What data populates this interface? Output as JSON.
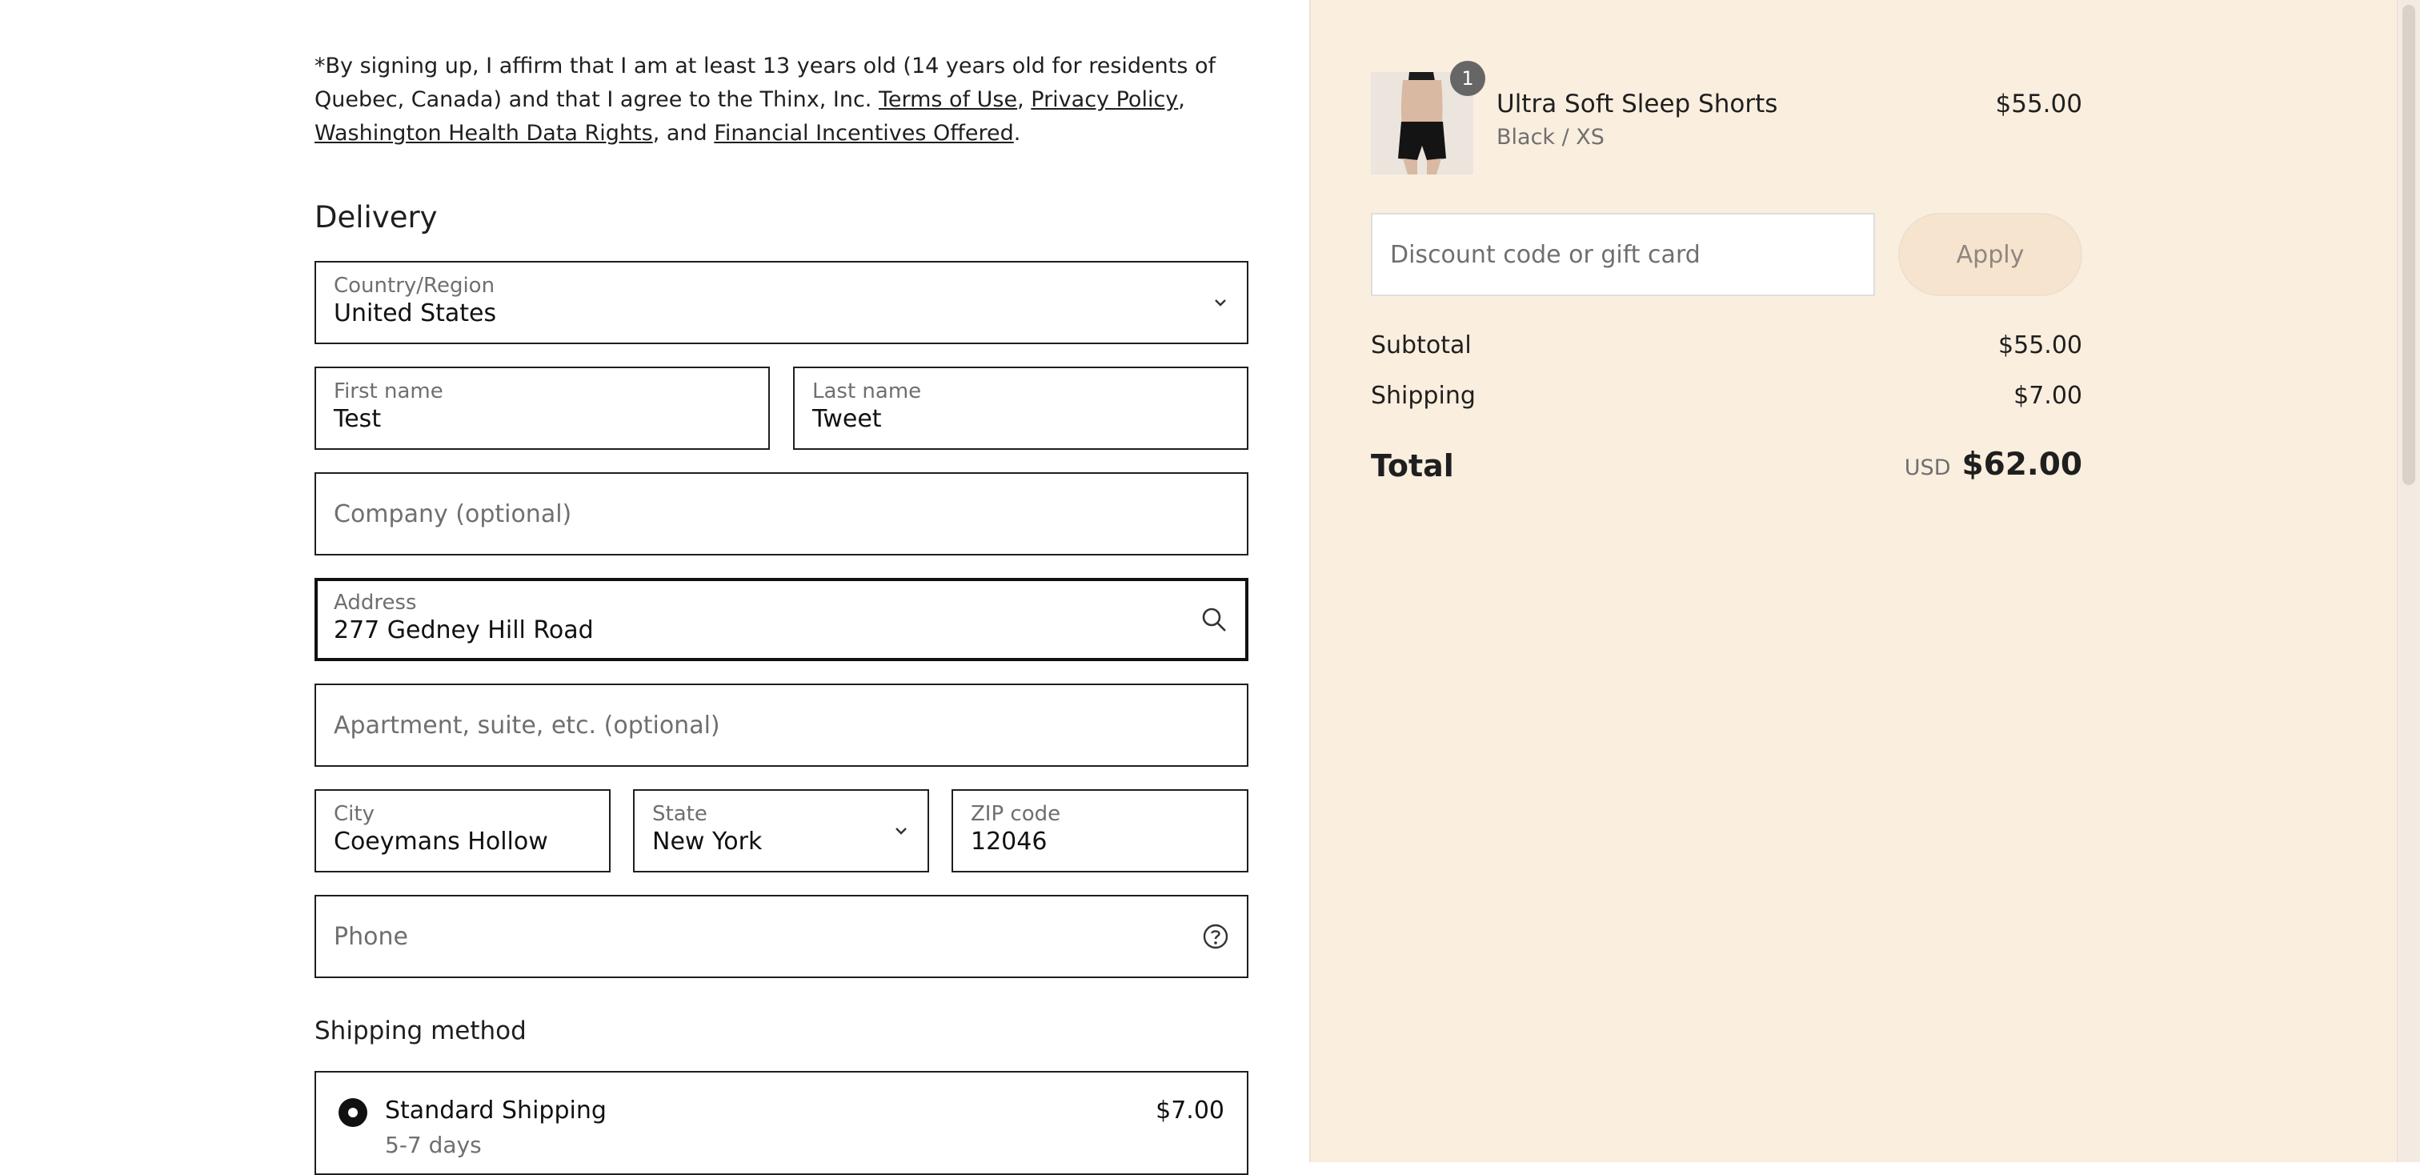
{
  "disclaimer": {
    "text_1": "*By signing up, I affirm that I am at least 13 years old (14 years old for residents of Quebec, Canada) and that I agree to the Thinx, Inc. ",
    "terms_link": "Terms of Use",
    "sep_1": ", ",
    "privacy_link": "Privacy Policy",
    "sep_2": ", ",
    "washington_link": "Washington Health Data Rights",
    "sep_3": ", and ",
    "financial_link": "Financial Incentives Offered",
    "end": "."
  },
  "delivery": {
    "title": "Delivery",
    "country": {
      "label": "Country/Region",
      "value": "United States"
    },
    "first_name": {
      "label": "First name",
      "value": "Test"
    },
    "last_name": {
      "label": "Last name",
      "value": "Tweet"
    },
    "company": {
      "placeholder": "Company (optional)"
    },
    "address": {
      "label": "Address",
      "value": "277 Gedney Hill Road"
    },
    "apartment": {
      "placeholder": "Apartment, suite, etc. (optional)"
    },
    "city": {
      "label": "City",
      "value": "Coeymans Hollow"
    },
    "state": {
      "label": "State",
      "value": "New York"
    },
    "zip": {
      "label": "ZIP code",
      "value": "12046"
    },
    "phone": {
      "placeholder": "Phone"
    }
  },
  "shipping_method": {
    "title": "Shipping method",
    "option": {
      "name": "Standard Shipping",
      "days": "5-7 days",
      "price": "$7.00"
    }
  },
  "summary": {
    "product": {
      "quantity": "1",
      "name": "Ultra Soft Sleep Shorts",
      "variant": "Black / XS",
      "price": "$55.00"
    },
    "discount_placeholder": "Discount code or gift card",
    "apply_label": "Apply",
    "subtotal_label": "Subtotal",
    "subtotal_value": "$55.00",
    "shipping_label": "Shipping",
    "shipping_value": "$7.00",
    "total_label": "Total",
    "total_currency": "USD",
    "total_value": "$62.00"
  },
  "icons": {
    "dropdown": "chevron-down-icon",
    "address_search": "search-icon",
    "phone_help": "help-circle-icon"
  }
}
